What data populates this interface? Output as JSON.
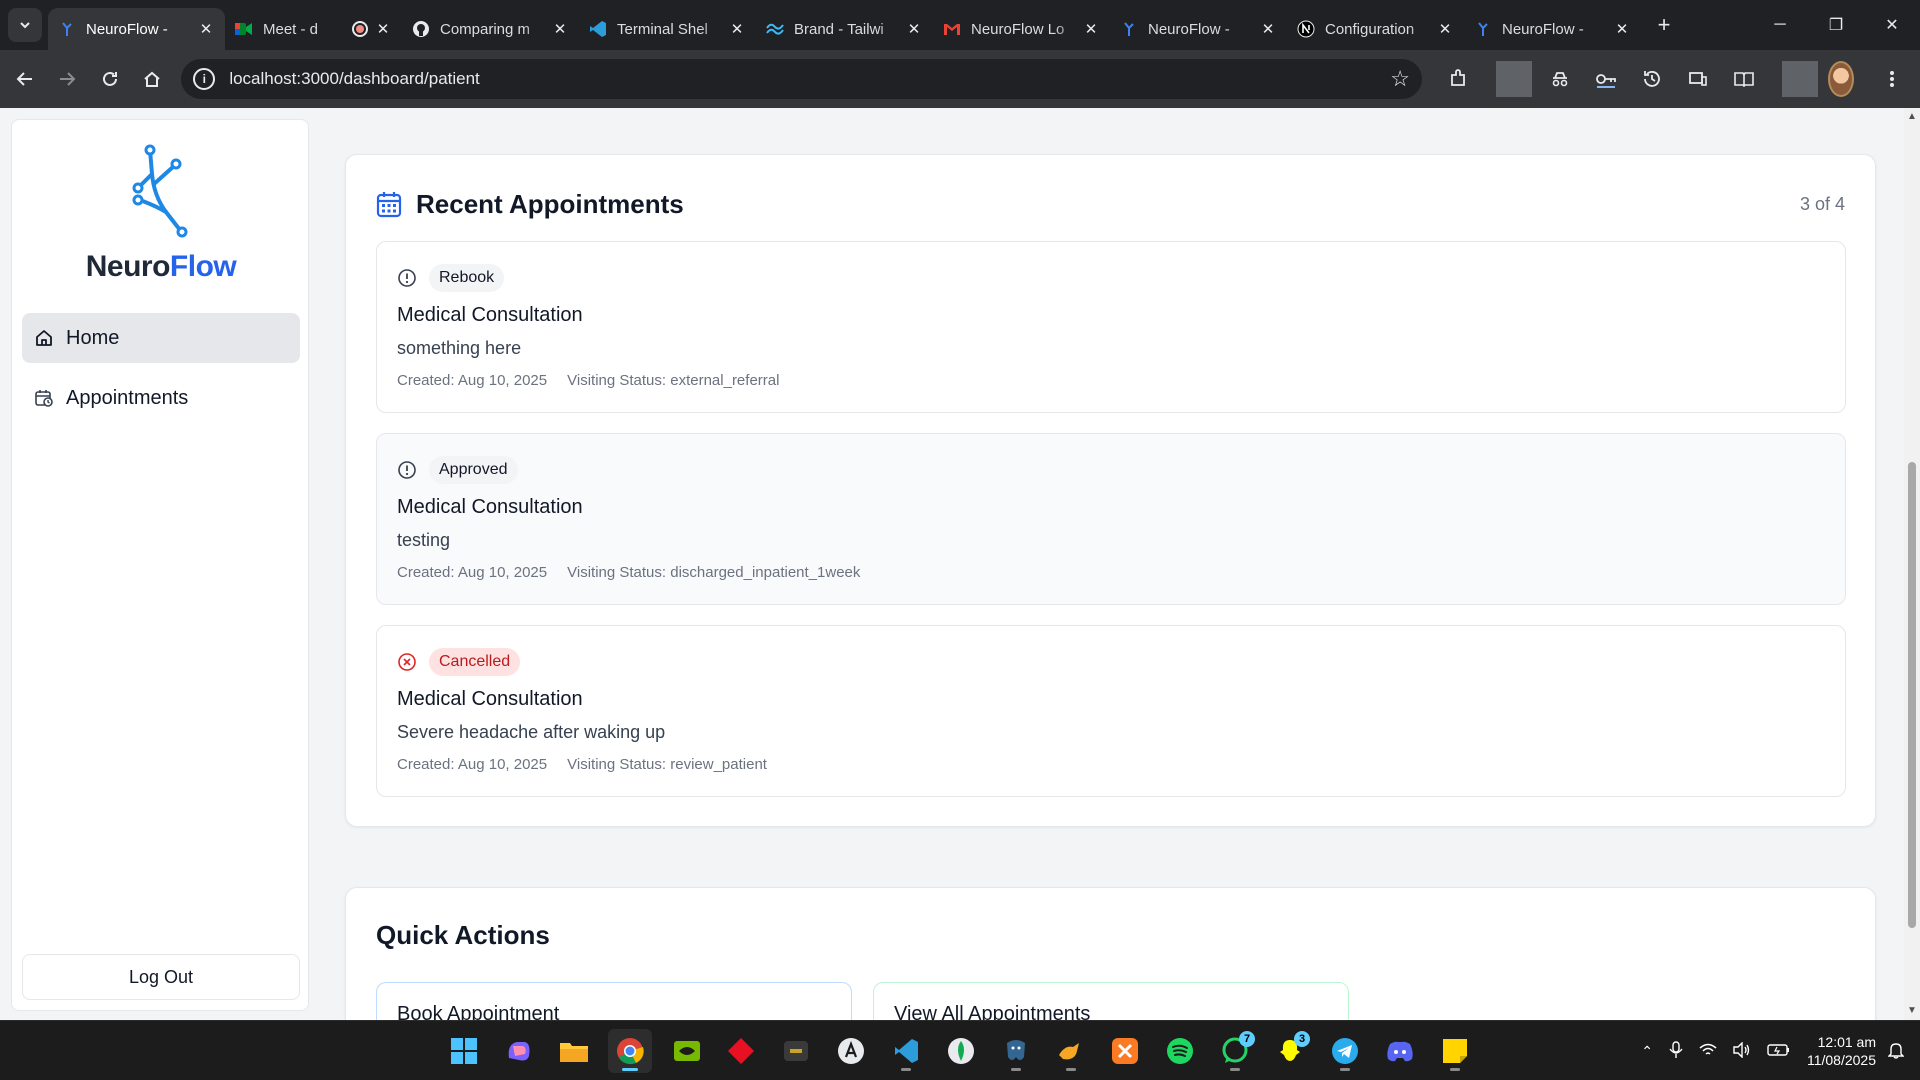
{
  "browser": {
    "tabs": [
      {
        "title": "NeuroFlow - ",
        "icon": "neuroflow-icon",
        "active": true
      },
      {
        "title": "Meet - d",
        "icon": "google-meet-icon",
        "active": false,
        "recording": true
      },
      {
        "title": "Comparing m",
        "icon": "github-icon",
        "active": false
      },
      {
        "title": "Terminal Shel",
        "icon": "vscode-icon",
        "active": false
      },
      {
        "title": "Brand - Tailwi",
        "icon": "tailwind-icon",
        "active": false
      },
      {
        "title": "NeuroFlow Lo",
        "icon": "gmail-icon",
        "active": false
      },
      {
        "title": "NeuroFlow - ",
        "icon": "neuroflow-icon",
        "active": false
      },
      {
        "title": "Configuration",
        "icon": "nextjs-icon",
        "active": false
      },
      {
        "title": "NeuroFlow - ",
        "icon": "neuroflow-icon",
        "active": false
      }
    ],
    "url": "localhost:3000/dashboard/patient"
  },
  "sidebar": {
    "brand_main": "Neuro",
    "brand_accent": "Flow",
    "items": [
      {
        "label": "Home",
        "icon": "home-icon",
        "active": true
      },
      {
        "label": "Appointments",
        "icon": "calendar-clock-icon",
        "active": false
      }
    ],
    "logout_label": "Log Out"
  },
  "recent": {
    "title": "Recent Appointments",
    "count": "3 of 4",
    "appointments": [
      {
        "status": "Rebook",
        "status_icon": "alert-circle-icon",
        "title": "Medical Consultation",
        "description": "something here",
        "created": "Created: Aug 10, 2025",
        "visiting": "Visiting Status: external_referral"
      },
      {
        "status": "Approved",
        "status_icon": "alert-circle-icon",
        "title": "Medical Consultation",
        "description": "testing",
        "created": "Created: Aug 10, 2025",
        "visiting": "Visiting Status: discharged_inpatient_1week"
      },
      {
        "status": "Cancelled",
        "status_icon": "x-circle-icon",
        "title": "Medical Consultation",
        "description": "Severe headache after waking up",
        "created": "Created: Aug 10, 2025",
        "visiting": "Visiting Status: review_patient"
      }
    ]
  },
  "quick_actions": {
    "title": "Quick Actions",
    "book": "Book Appointment",
    "view_all": "View All Appointments"
  },
  "taskbar": {
    "time": "12:01 am",
    "date": "11/08/2025",
    "whatsapp_badge": "7",
    "snapchat_badge": "3"
  },
  "colors": {
    "brand_blue": "#2563eb",
    "cancel_red": "#dc2626",
    "cancel_bg": "#fee2e2"
  }
}
